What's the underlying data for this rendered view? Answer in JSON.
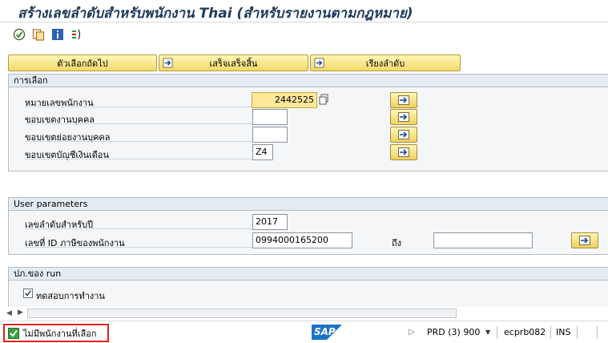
{
  "title": "สร้างเลขลำดับสำหรับพนักงาน Thai (สำหรับรายงานตามกฎหมาย)",
  "toolbar": {
    "icons": [
      "execute-icon",
      "variant-icon",
      "info-icon",
      "selection-options-icon"
    ]
  },
  "buttons": {
    "next_selection": "ตัวเลือกถัดไป",
    "complete": "เสร็จเสร็จสิ้น",
    "sort": "เรียงลำดับ"
  },
  "selection": {
    "title": "การเลือก",
    "rows": [
      {
        "label": "หมายเลขพนักงาน",
        "value": "2442525"
      },
      {
        "label": "ขอบเขตงานบุคคล",
        "value": ""
      },
      {
        "label": "ขอบเขตย่อยงานบุคคล",
        "value": ""
      },
      {
        "label": "ขอบเขตบัญชีเงินเดือน",
        "value": "Z4"
      }
    ]
  },
  "user_params": {
    "title": "User parameters",
    "year_label": "เลขลำดับสำหรับปี",
    "year_value": "2017",
    "taxid_label": "เลขที่ ID ภาษีของพนักงาน",
    "taxid_value": "0994000165200",
    "to_label": "ถึง",
    "to_value": ""
  },
  "run": {
    "title": "ปภ.ของ run",
    "test_label": "ทดสอบการทำงาน",
    "test_checked": true
  },
  "status": {
    "message": "ไม่มีพนักงานที่เลือก",
    "brand": "SAP",
    "system": "PRD (3) 900",
    "host": "ecprb082",
    "mode": "INS"
  },
  "colors": {
    "title": "#1f3a5a",
    "button_top": "#fff7b8",
    "button_bottom": "#f4d86a",
    "status_border": "#e02020",
    "sap_blue": "#1a75c9"
  }
}
